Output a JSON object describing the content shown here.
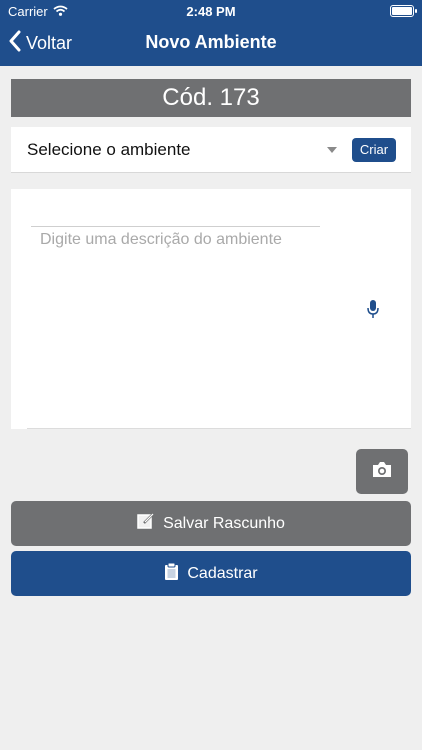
{
  "status_bar": {
    "carrier": "Carrier",
    "time": "2:48 PM"
  },
  "nav": {
    "back_label": "Voltar",
    "title": "Novo Ambiente"
  },
  "code_header": "Cód. 173",
  "environment_select": {
    "selected_value": "Selecione o ambiente",
    "create_label": "Criar"
  },
  "description": {
    "placeholder": "Digite uma descrição do ambiente"
  },
  "actions": {
    "save_draft_label": "Salvar Rascunho",
    "submit_label": "Cadastrar"
  },
  "colors": {
    "primary": "#1f4e8c",
    "secondary": "#6f7072",
    "background": "#efefef"
  },
  "icons": [
    "wifi-icon",
    "battery-icon",
    "chevron-left-icon",
    "dropdown-caret-icon",
    "microphone-icon",
    "camera-icon",
    "edit-icon",
    "clipboard-icon"
  ]
}
